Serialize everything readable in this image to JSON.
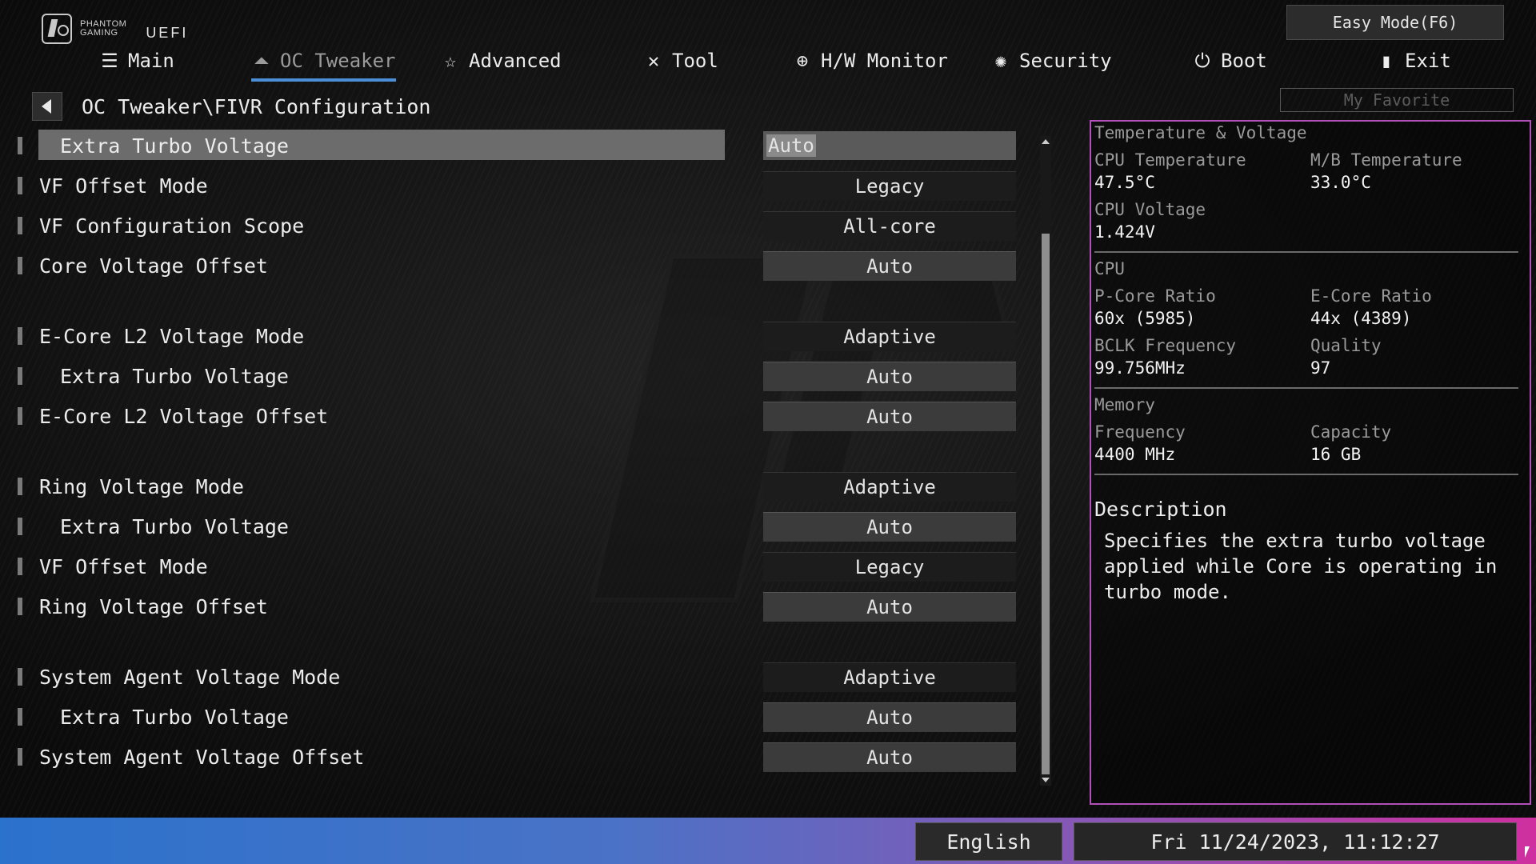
{
  "header": {
    "logo_line1": "PHANTOM",
    "logo_line2": "GAMING",
    "uefi": "UEFI",
    "easy_mode": "Easy Mode(F6)",
    "nav": [
      {
        "label": "Main",
        "icon": "list-icon"
      },
      {
        "label": "OC Tweaker",
        "icon": "rocket-icon"
      },
      {
        "label": "Advanced",
        "icon": "star-icon"
      },
      {
        "label": "Tool",
        "icon": "tools-icon"
      },
      {
        "label": "H/W Monitor",
        "icon": "monitor-icon"
      },
      {
        "label": "Security",
        "icon": "shield-icon"
      },
      {
        "label": "Boot",
        "icon": "power-icon"
      },
      {
        "label": "Exit",
        "icon": "exit-icon"
      }
    ],
    "active_tab": "OC Tweaker"
  },
  "breadcrumb": "OC Tweaker\\FIVR Configuration",
  "my_favorite": "My Favorite",
  "settings": [
    {
      "label": "Extra Turbo Voltage",
      "value": "Auto",
      "indent": true,
      "selected": true
    },
    {
      "label": "VF Offset Mode",
      "value": "Legacy",
      "indent": false
    },
    {
      "label": "VF Configuration Scope",
      "value": "All-core",
      "indent": false
    },
    {
      "label": "Core Voltage Offset",
      "value": "Auto",
      "indent": false
    },
    {
      "label": "E-Core L2 Voltage Mode",
      "value": "Adaptive",
      "indent": false
    },
    {
      "label": "Extra Turbo Voltage",
      "value": "Auto",
      "indent": true
    },
    {
      "label": "E-Core L2 Voltage Offset",
      "value": "Auto",
      "indent": false
    },
    {
      "label": "Ring Voltage Mode",
      "value": "Adaptive",
      "indent": false
    },
    {
      "label": "Extra Turbo Voltage",
      "value": "Auto",
      "indent": true
    },
    {
      "label": "VF Offset Mode",
      "value": "Legacy",
      "indent": false
    },
    {
      "label": "Ring Voltage Offset",
      "value": "Auto",
      "indent": false
    },
    {
      "label": "System Agent Voltage Mode",
      "value": "Adaptive",
      "indent": false
    },
    {
      "label": "Extra Turbo Voltage",
      "value": "Auto",
      "indent": true
    },
    {
      "label": "System Agent Voltage Offset",
      "value": "Auto",
      "indent": false
    }
  ],
  "panel": {
    "title": "Temperature & Voltage",
    "cpu_temp_label": "CPU Temperature",
    "cpu_temp": "47.5°C",
    "mb_temp_label": "M/B Temperature",
    "mb_temp": "33.0°C",
    "cpu_voltage_label": "CPU Voltage",
    "cpu_voltage": "1.424V",
    "cpu_section": "CPU",
    "pcore_label": "P-Core Ratio",
    "pcore": "60x (5985)",
    "ecore_label": "E-Core Ratio",
    "ecore": "44x (4389)",
    "bclk_label": "BCLK Frequency",
    "bclk": "99.756MHz",
    "quality_label": "Quality",
    "quality": "97",
    "memory_section": "Memory",
    "freq_label": "Frequency",
    "freq": "4400 MHz",
    "capacity_label": "Capacity",
    "capacity": "16 GB",
    "description_title": "Description",
    "description": "Specifies the extra turbo voltage\napplied while Core is operating in\nturbo mode."
  },
  "footer": {
    "language": "English",
    "datetime": "Fri 11/24/2023, 11:12:27"
  },
  "colors": {
    "accent_tab_underline": "#4b8fd8",
    "panel_border": "#b050b8",
    "bottom_gradient_start": "#2b72cc",
    "bottom_gradient_end": "#cf2fa0"
  }
}
